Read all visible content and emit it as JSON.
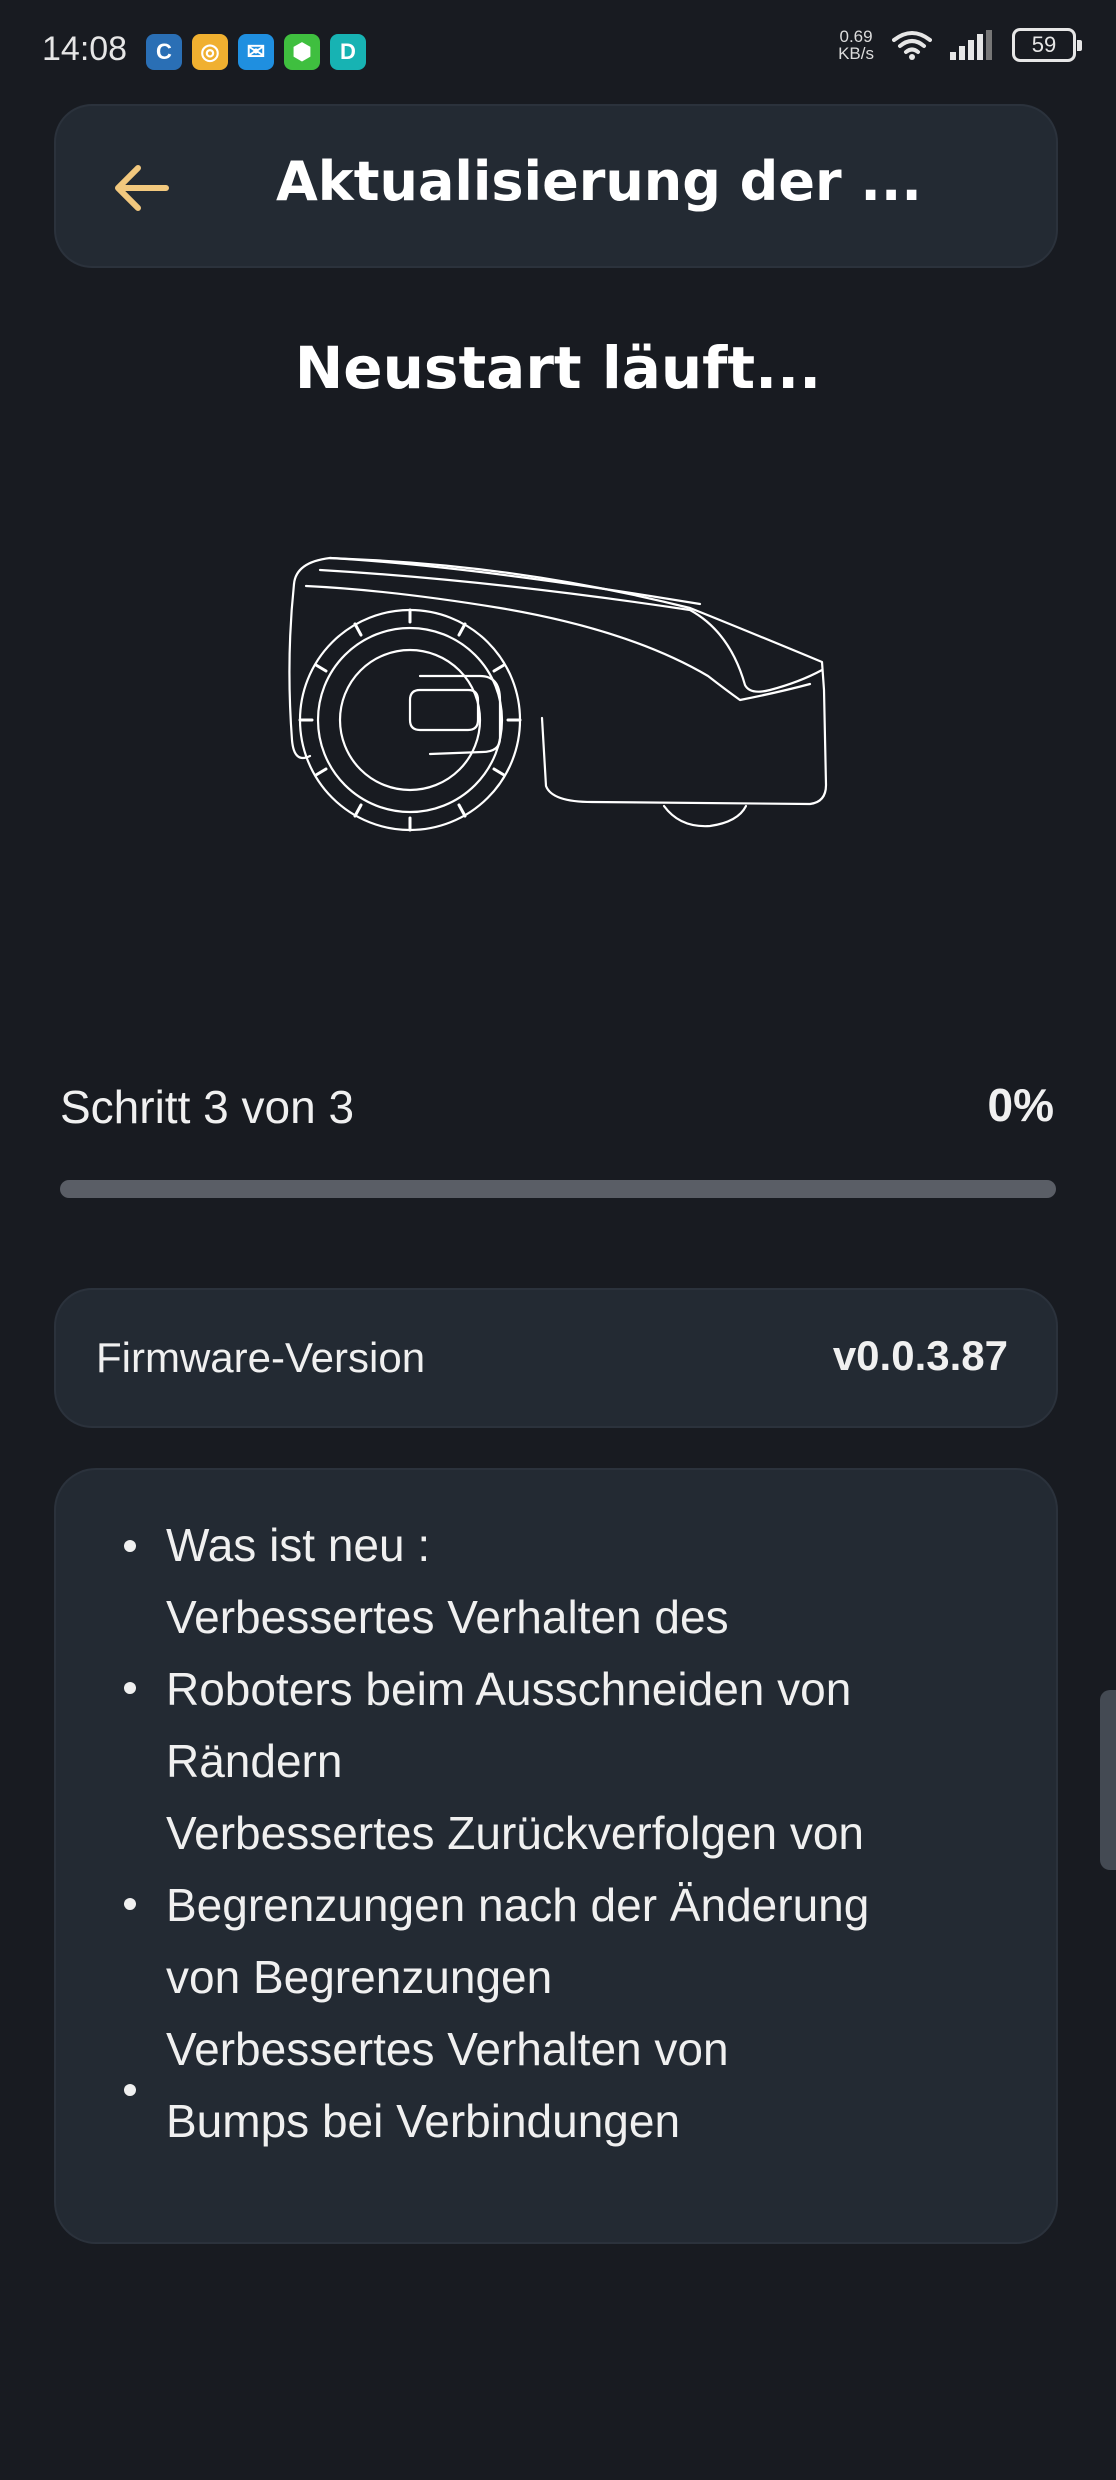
{
  "status_bar": {
    "time": "14:08",
    "net_speed_value": "0.69",
    "net_speed_unit": "KB/s",
    "battery": "59",
    "apps": [
      {
        "icon": "sync-app-icon",
        "glyph": "C",
        "color": "#2a6fb5"
      },
      {
        "icon": "browser-app-icon",
        "glyph": "◎",
        "color": "#f0b030"
      },
      {
        "icon": "mail-app-icon",
        "glyph": "✉",
        "color": "#1f8fe0"
      },
      {
        "icon": "security-app-icon",
        "glyph": "⬢",
        "color": "#3fbf3f"
      },
      {
        "icon": "bubble-app-icon",
        "glyph": "D",
        "color": "#17b3b3"
      }
    ]
  },
  "header": {
    "title": "Aktualisierung der ..."
  },
  "main": {
    "heading": "Neustart läuft..."
  },
  "progress": {
    "step_text": "Schritt 3 von 3",
    "percent_text": "0%",
    "fraction": 0
  },
  "firmware": {
    "label": "Firmware-Version",
    "value": "v0.0.3.87"
  },
  "notes": {
    "lines": [
      "Was ist neu :",
      "Verbessertes Verhalten des",
      "Roboters beim Ausschneiden von",
      "Rändern",
      "Verbessertes Zurückverfolgen von",
      "Begrenzungen nach der Änderung",
      "von Begrenzungen",
      "Verbessertes Verhalten von",
      "Bumps bei Verbindungen"
    ]
  },
  "colors": {
    "background": "#181b21",
    "card": "#232a33",
    "accent": "#f2c87e",
    "progress_track": "#5a5e66"
  }
}
